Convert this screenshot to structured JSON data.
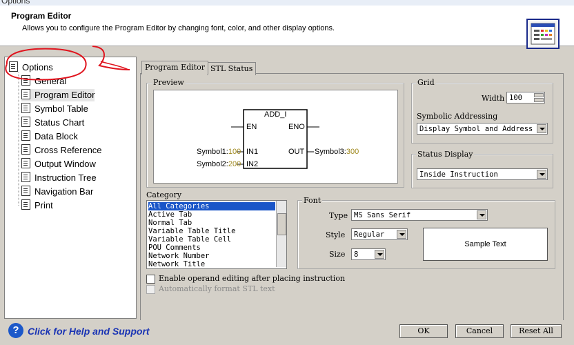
{
  "window": {
    "title_partial": "Options"
  },
  "header": {
    "title": "Program Editor",
    "subtitle": "Allows you to configure the Program Editor by changing font, color, and other display options."
  },
  "tree": {
    "root": "Options",
    "items": [
      {
        "label": "General"
      },
      {
        "label": "Program Editor"
      },
      {
        "label": "Symbol Table"
      },
      {
        "label": "Status Chart"
      },
      {
        "label": "Data Block"
      },
      {
        "label": "Cross Reference"
      },
      {
        "label": "Output Window"
      },
      {
        "label": "Instruction Tree"
      },
      {
        "label": "Navigation Bar"
      },
      {
        "label": "Print"
      }
    ]
  },
  "tabs": [
    {
      "label": "Program Editor"
    },
    {
      "label": "STL Status"
    }
  ],
  "preview": {
    "label": "Preview",
    "block_name": "ADD_I",
    "en": "EN",
    "eno": "ENO",
    "in1": "IN1",
    "in2": "IN2",
    "out": "OUT",
    "symbol1": "Symbol1:",
    "value1": "100",
    "symbol2": "Symbol2:",
    "value2": "200",
    "symbol3": "Symbol3:",
    "value3": "300",
    "value_color": "#a08a20"
  },
  "grid": {
    "label": "Grid",
    "width_label": "Width",
    "width_value": "100"
  },
  "symbolic": {
    "label": "Symbolic Addressing",
    "value": "Display Symbol and Address"
  },
  "status_display": {
    "label": "Status Display",
    "value": "Inside Instruction"
  },
  "category": {
    "label": "Category",
    "items": [
      "All Categories",
      "Active Tab",
      "Normal Tab",
      "Variable Table Title",
      "Variable Table Cell",
      "POU Comments",
      "Network Number",
      "Network Title"
    ],
    "selected_index": 0
  },
  "font": {
    "label": "Font",
    "type_label": "Type",
    "type_value": "MS Sans Serif",
    "style_label": "Style",
    "style_value": "Regular",
    "size_label": "Size",
    "size_value": "8",
    "sample": "Sample Text"
  },
  "options": {
    "enable_operand": "Enable operand editing after placing instruction",
    "auto_format": "Automatically format STL text"
  },
  "footer": {
    "help": "Click for Help and Support",
    "ok": "OK",
    "cancel": "Cancel",
    "reset": "Reset All"
  },
  "colors": {
    "annotation": "#e0141e",
    "selection": "#1a55c8",
    "help_link": "#1a34b4"
  }
}
